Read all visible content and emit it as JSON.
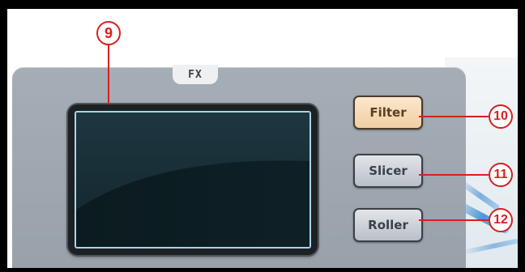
{
  "panel": {
    "tab_label": "FX"
  },
  "buttons": [
    {
      "label": "Filter",
      "active": true
    },
    {
      "label": "Slicer",
      "active": false
    },
    {
      "label": "Roller",
      "active": false
    }
  ],
  "callouts": {
    "screen": "9",
    "filter": "10",
    "slicer": "11",
    "roller": "12"
  },
  "colors": {
    "callout": "#d62020",
    "panel": "#a1a9b1",
    "screen_dark": "#0f2127",
    "screen_border": "#a9d4e8",
    "active_button": "#f6dcb8"
  }
}
